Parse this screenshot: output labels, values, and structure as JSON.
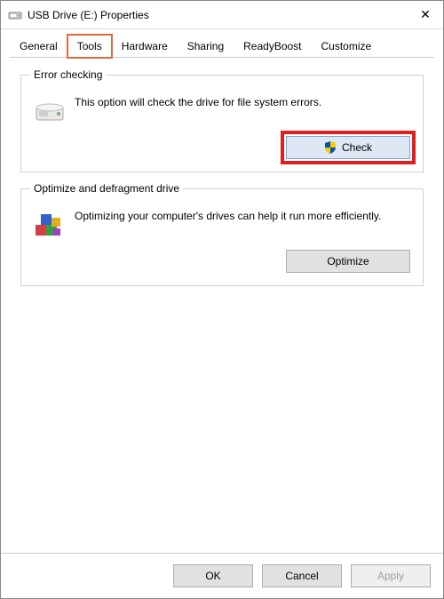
{
  "window": {
    "title": "USB Drive (E:) Properties"
  },
  "tabs": {
    "general": {
      "label": "General"
    },
    "tools": {
      "label": "Tools"
    },
    "hardware": {
      "label": "Hardware"
    },
    "sharing": {
      "label": "Sharing"
    },
    "readyboost": {
      "label": "ReadyBoost"
    },
    "customize": {
      "label": "Customize"
    }
  },
  "error_checking": {
    "legend": "Error checking",
    "description": "This option will check the drive for file system errors.",
    "button": "Check"
  },
  "optimize": {
    "legend": "Optimize and defragment drive",
    "description": "Optimizing your computer's drives can help it run more efficiently.",
    "button": "Optimize"
  },
  "footer": {
    "ok": "OK",
    "cancel": "Cancel",
    "apply": "Apply"
  }
}
